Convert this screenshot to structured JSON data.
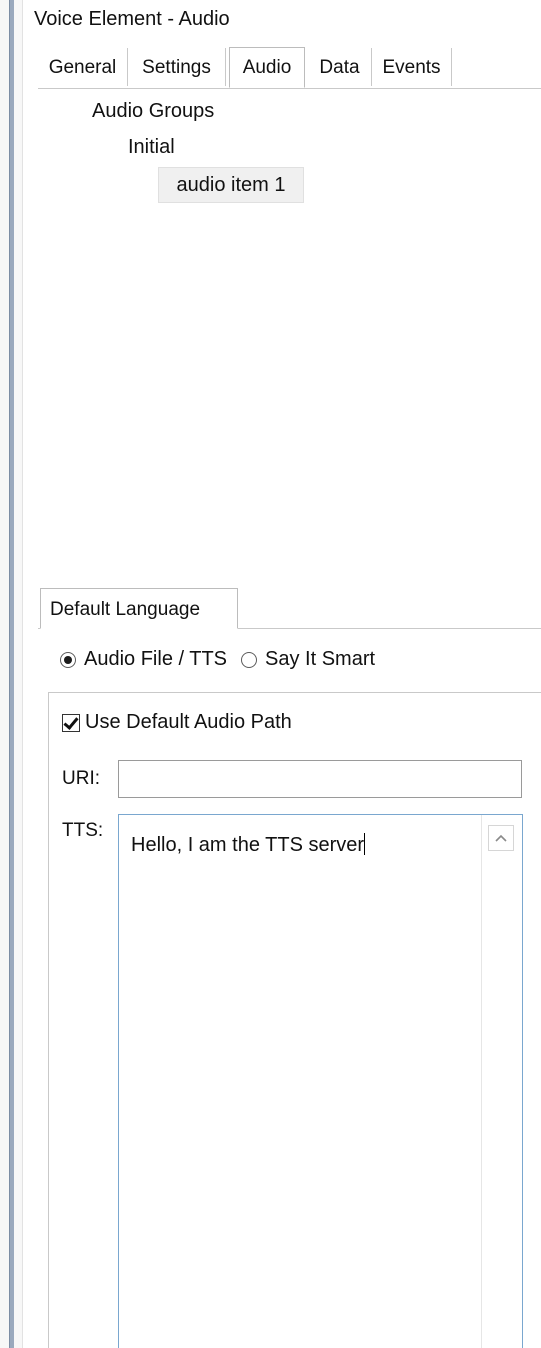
{
  "window": {
    "title": "Voice Element - Audio"
  },
  "tabs": [
    {
      "label": "General",
      "active": false
    },
    {
      "label": "Settings",
      "active": false
    },
    {
      "label": "Audio",
      "active": true
    },
    {
      "label": "Data",
      "active": false
    },
    {
      "label": "Events",
      "active": false
    }
  ],
  "tree": {
    "root": "Audio Groups",
    "group": "Initial",
    "item": "audio item 1"
  },
  "language_tab": {
    "label": "Default Language"
  },
  "audio_mode": {
    "options": [
      {
        "label": "Audio File / TTS",
        "checked": true
      },
      {
        "label": "Say It Smart",
        "checked": false
      }
    ]
  },
  "audio_path": {
    "use_default_label": "Use Default Audio Path",
    "use_default_checked": true
  },
  "fields": {
    "uri_label": "URI:",
    "uri_value": "",
    "tts_label": "TTS:",
    "tts_value": "Hello, I am the TTS server"
  },
  "icons": {
    "scroll_up": "chevron-up-icon"
  }
}
